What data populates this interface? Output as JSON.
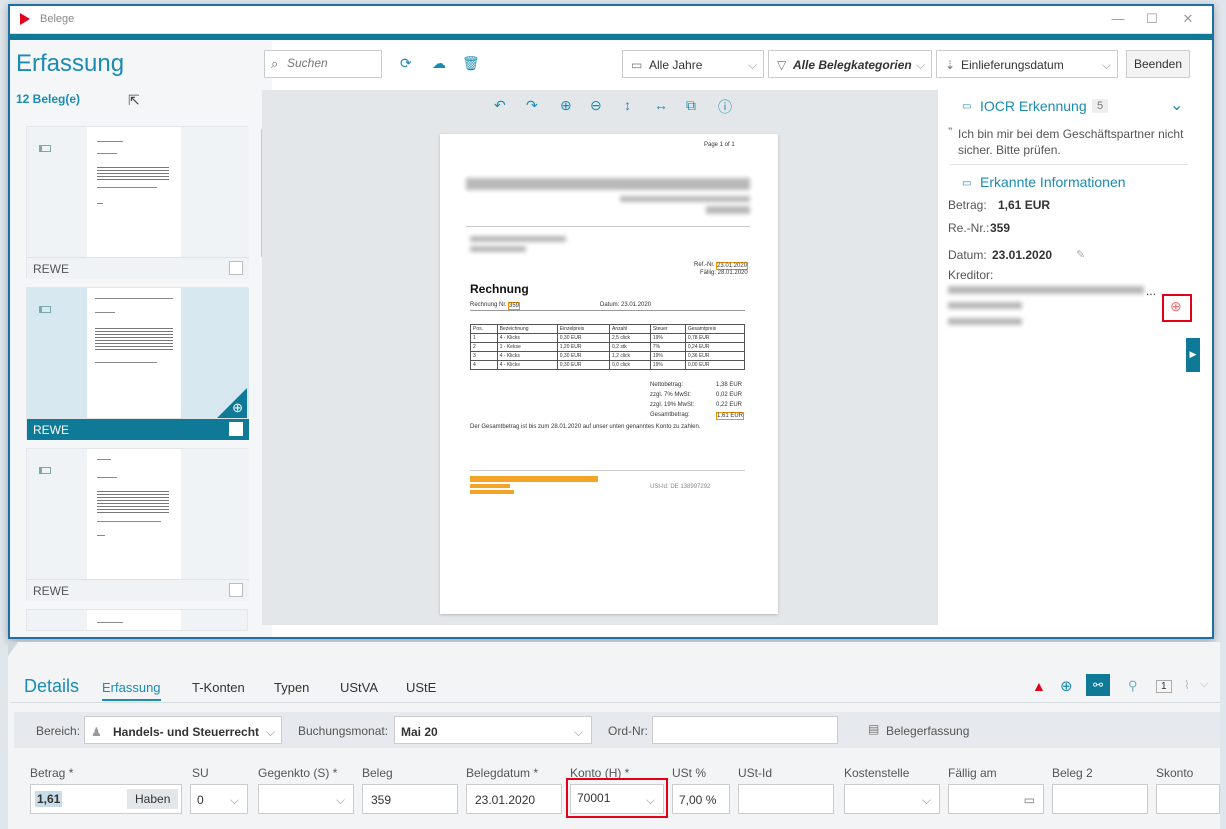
{
  "window": {
    "title": "Belege",
    "minimize": "—",
    "maximize": "☐",
    "close": "✕"
  },
  "left": {
    "heading": "Erfassung",
    "count": "12 Beleg(e)",
    "cards": [
      {
        "label": "REWE",
        "selected": false
      },
      {
        "label": "REWE",
        "selected": true
      },
      {
        "label": "REWE",
        "selected": false
      }
    ]
  },
  "toolbar": {
    "search_placeholder": "Suchen",
    "years": "Alle Jahre",
    "categories": "Alle Belegkategorien",
    "sort": "Einlieferungsdatum",
    "end": "Beenden"
  },
  "document": {
    "page_info": "Page 1 of 1",
    "heading": "Rechnung",
    "invoice_label": "Rechnung Nr.",
    "invoice_no": "359",
    "date_text": "Datum: 23.01.2020",
    "ref_label": "Ref.-Nr.",
    "ref_date": "23.01.2020",
    "due_text": "Fällig: 28.01.2020",
    "columns": [
      "Pos.",
      "Bezeichnung",
      "Einzelpreis",
      "Anzahl",
      "Steuer",
      "Gesamtpreis"
    ],
    "rows": [
      [
        "1",
        "4 - Klicks",
        "0,30 EUR",
        "2,5 click",
        "19%",
        "0,78 EUR"
      ],
      [
        "2",
        "1 - Kekse",
        "1,20 EUR",
        "0,2 stk",
        "7%",
        "0,24 EUR"
      ],
      [
        "3",
        "4 - Klicks",
        "0,30 EUR",
        "1,2 click",
        "19%",
        "0,36 EUR"
      ],
      [
        "4",
        "4 - Klicks",
        "0,30 EUR",
        "0,0 click",
        "19%",
        "0,00 EUR"
      ]
    ],
    "totals": [
      [
        "Nettobetrag:",
        "1,38 EUR"
      ],
      [
        "zzgl. 7% MwSt:",
        "0,02 EUR"
      ],
      [
        "zzgl. 19% MwSt:",
        "0,22 EUR"
      ],
      [
        "Gesamtbetrag:",
        "1,61 EUR"
      ]
    ],
    "note": "Der Gesamtbetrag ist bis zum 28.01.2020 auf unser unten genanntes Konto zu zahlen.",
    "ust": "USt-Id: DE 138997292"
  },
  "ocr": {
    "title": "IOCR Erkennung",
    "badge": "5",
    "hint": "Ich bin mir bei dem Geschäftspartner nicht sicher. Bitte prüfen.",
    "info_title": "Erkannte Informationen",
    "amount_label": "Betrag:",
    "amount": "1,61 EUR",
    "invoice_label": "Re.-Nr.:",
    "invoice": "359",
    "date_label": "Datum:",
    "date": "23.01.2020",
    "creditor_label": "Kreditor:",
    "ellipsis": "..."
  },
  "details": {
    "title": "Details",
    "tabs": [
      "Erfassung",
      "T-Konten",
      "Typen",
      "UStVA",
      "UStE"
    ],
    "badge_count": "1",
    "area_label": "Bereich:",
    "area_value": "Handels- und Steuerrecht",
    "month_label": "Buchungsmonat:",
    "month_value": "Mai 20",
    "ord_label": "Ord-Nr:",
    "capture_button": "Belegerfassung",
    "fields": {
      "betrag_label": "Betrag *",
      "betrag_value": "1,61",
      "haben": "Haben",
      "su_label": "SU",
      "su_value": "0",
      "gegenkto_label": "Gegenkto (S) *",
      "beleg_label": "Beleg",
      "beleg_value": "359",
      "belegdatum_label": "Belegdatum *",
      "belegdatum_value": "23.01.2020",
      "konto_label": "Konto (H) *",
      "konto_value": "70001",
      "ust_label": "USt %",
      "ust_value": "7,00 %",
      "ustid_label": "USt-Id",
      "kostenstelle_label": "Kostenstelle",
      "faellig_label": "Fällig am",
      "beleg2_label": "Beleg 2",
      "skonto_label": "Skonto"
    }
  }
}
